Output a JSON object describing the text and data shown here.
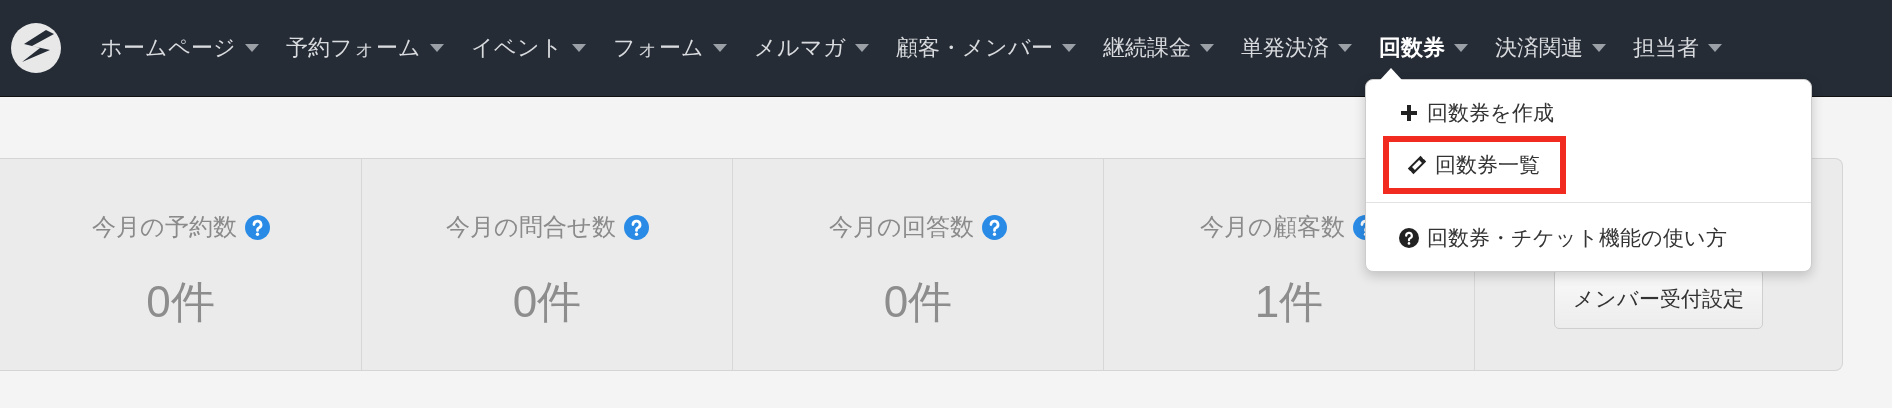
{
  "nav": {
    "items": [
      {
        "label": "ホームページ",
        "selected": false
      },
      {
        "label": "予約フォーム",
        "selected": false
      },
      {
        "label": "イベント",
        "selected": false
      },
      {
        "label": "フォーム",
        "selected": false
      },
      {
        "label": "メルマガ",
        "selected": false
      },
      {
        "label": "顧客・メンバー",
        "selected": false
      },
      {
        "label": "継続課金",
        "selected": false
      },
      {
        "label": "単発決済",
        "selected": false
      },
      {
        "label": "回数券",
        "selected": true
      },
      {
        "label": "決済関連",
        "selected": false
      },
      {
        "label": "担当者",
        "selected": false
      }
    ]
  },
  "dropdown": {
    "items": [
      {
        "kind": "create",
        "label": "回数券を作成",
        "highlighted": false
      },
      {
        "kind": "list",
        "label": "回数券一覧",
        "highlighted": true
      },
      {
        "kind": "help",
        "label": "回数券・チケット機能の使い方",
        "highlighted": false
      }
    ]
  },
  "stats": [
    {
      "label": "今月の予約数",
      "value": "0件"
    },
    {
      "label": "今月の問合せ数",
      "value": "0件"
    },
    {
      "label": "今月の回答数",
      "value": "0件"
    },
    {
      "label": "今月の顧客数",
      "value": "1件"
    }
  ],
  "member_button": {
    "label": "メンバー受付設定"
  }
}
